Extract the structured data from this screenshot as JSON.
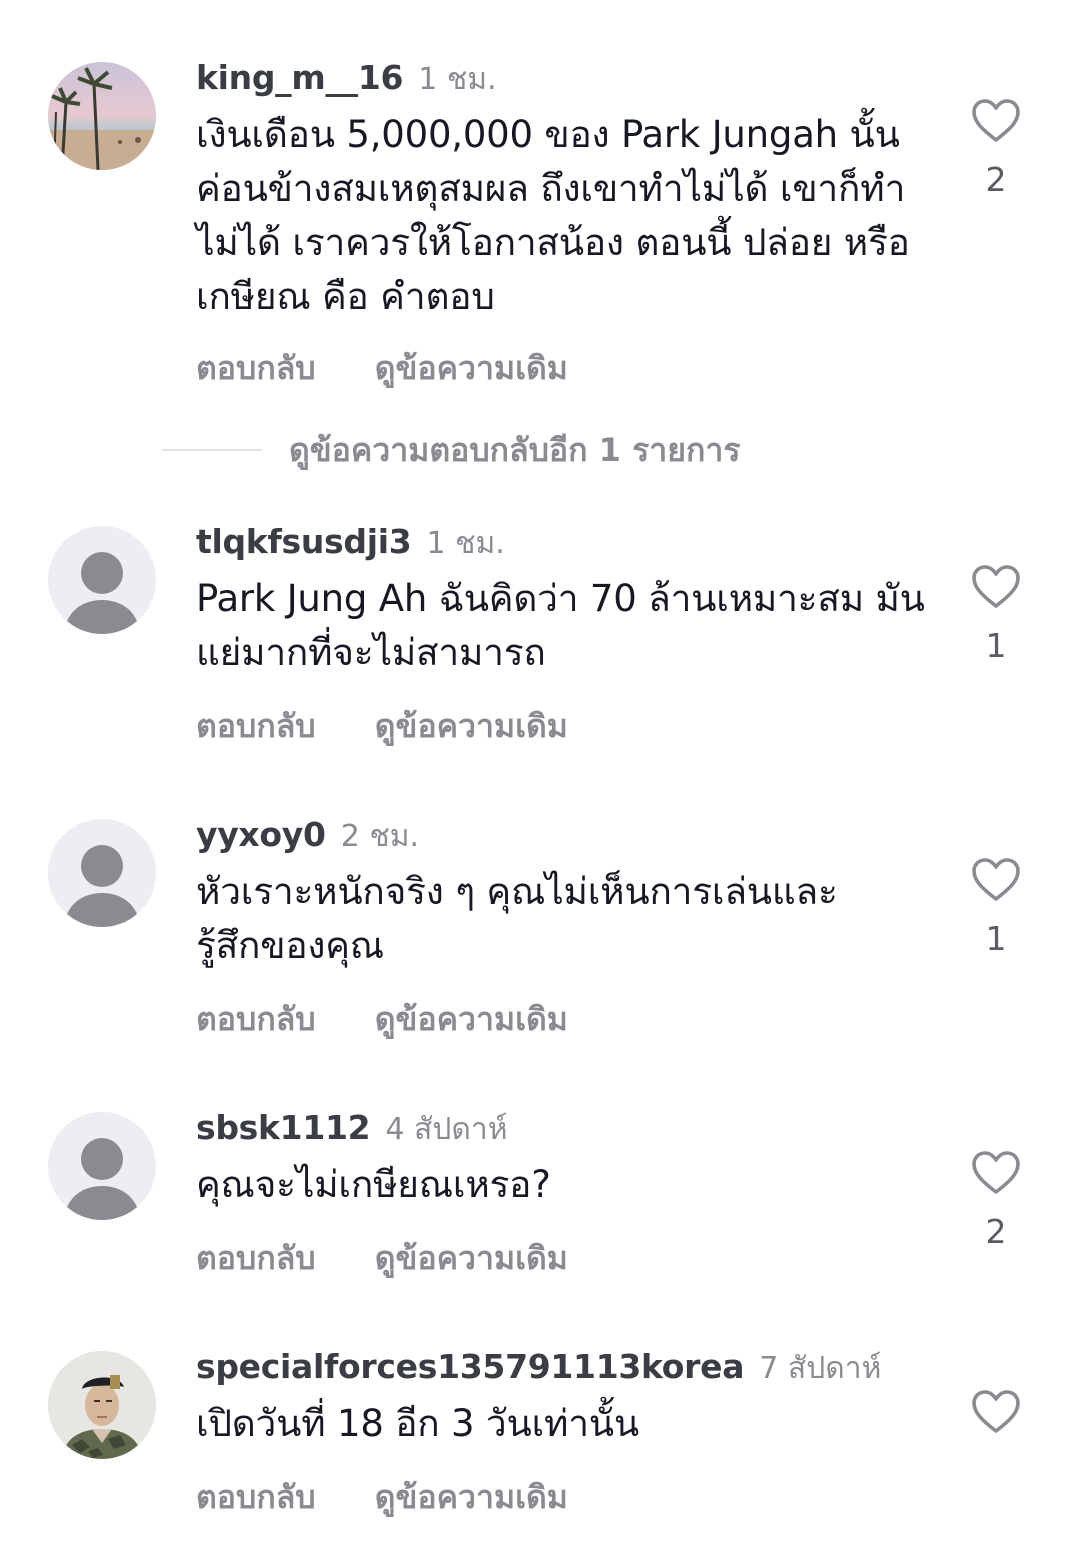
{
  "comments": [
    {
      "username": "king_m__16",
      "time": "1 ชม.",
      "text": "เงินเดือน 5,000,000 ของ Park Jungah นั้นค่อนข้างสมเหตุสมผล ถึงเขาทำไม่ได้ เขาก็ทำไม่ได้ เราควรให้โอกาสน้อง ตอนนี้ ปล่อย หรือ เกษียณ คือ คำตอบ",
      "likes": "2",
      "reply_label": "ตอบกลับ",
      "view_original_label": "ดูข้อความเดิม",
      "avatar": "beach-photo"
    },
    {
      "username": "tlqkfsusdji3",
      "time": "1 ชม.",
      "text": "Park Jung Ah ฉันคิดว่า 70 ล้านเหมาะสม มันแย่มากที่จะไม่สามารถ",
      "likes": "1",
      "reply_label": "ตอบกลับ",
      "view_original_label": "ดูข้อความเดิม",
      "avatar": "default-person"
    },
    {
      "username": "yyxoy0",
      "time": "2 ชม.",
      "text": "หัวเราะหนักจริง ๆ คุณไม่เห็นการเล่นและรู้สึกของคุณ",
      "likes": "1",
      "reply_label": "ตอบกลับ",
      "view_original_label": "ดูข้อความเดิม",
      "avatar": "default-person"
    },
    {
      "username": "sbsk1112",
      "time": "4 สัปดาห์",
      "text": "คุณจะไม่เกษียณเหรอ?",
      "likes": "2",
      "reply_label": "ตอบกลับ",
      "view_original_label": "ดูข้อความเดิม",
      "avatar": "default-person"
    },
    {
      "username": "specialforces135791113korea",
      "time": "7 สัปดาห์",
      "text": "เปิดวันที่ 18 อีก 3 วันเท่านั้น",
      "likes": "",
      "reply_label": "ตอบกลับ",
      "view_original_label": "ดูข้อความเดิม",
      "avatar": "soldier-photo"
    }
  ],
  "more_replies": {
    "label": "ดูข้อความตอบกลับอีก 1 รายการ"
  },
  "colors": {
    "text_primary": "#161823",
    "text_secondary": "#8a8b91",
    "username": "#3b3d44",
    "avatar_bg": "#eceef1",
    "avatar_silhouette": "#8a8b91"
  },
  "icons": {
    "like": "heart-outline-icon"
  }
}
